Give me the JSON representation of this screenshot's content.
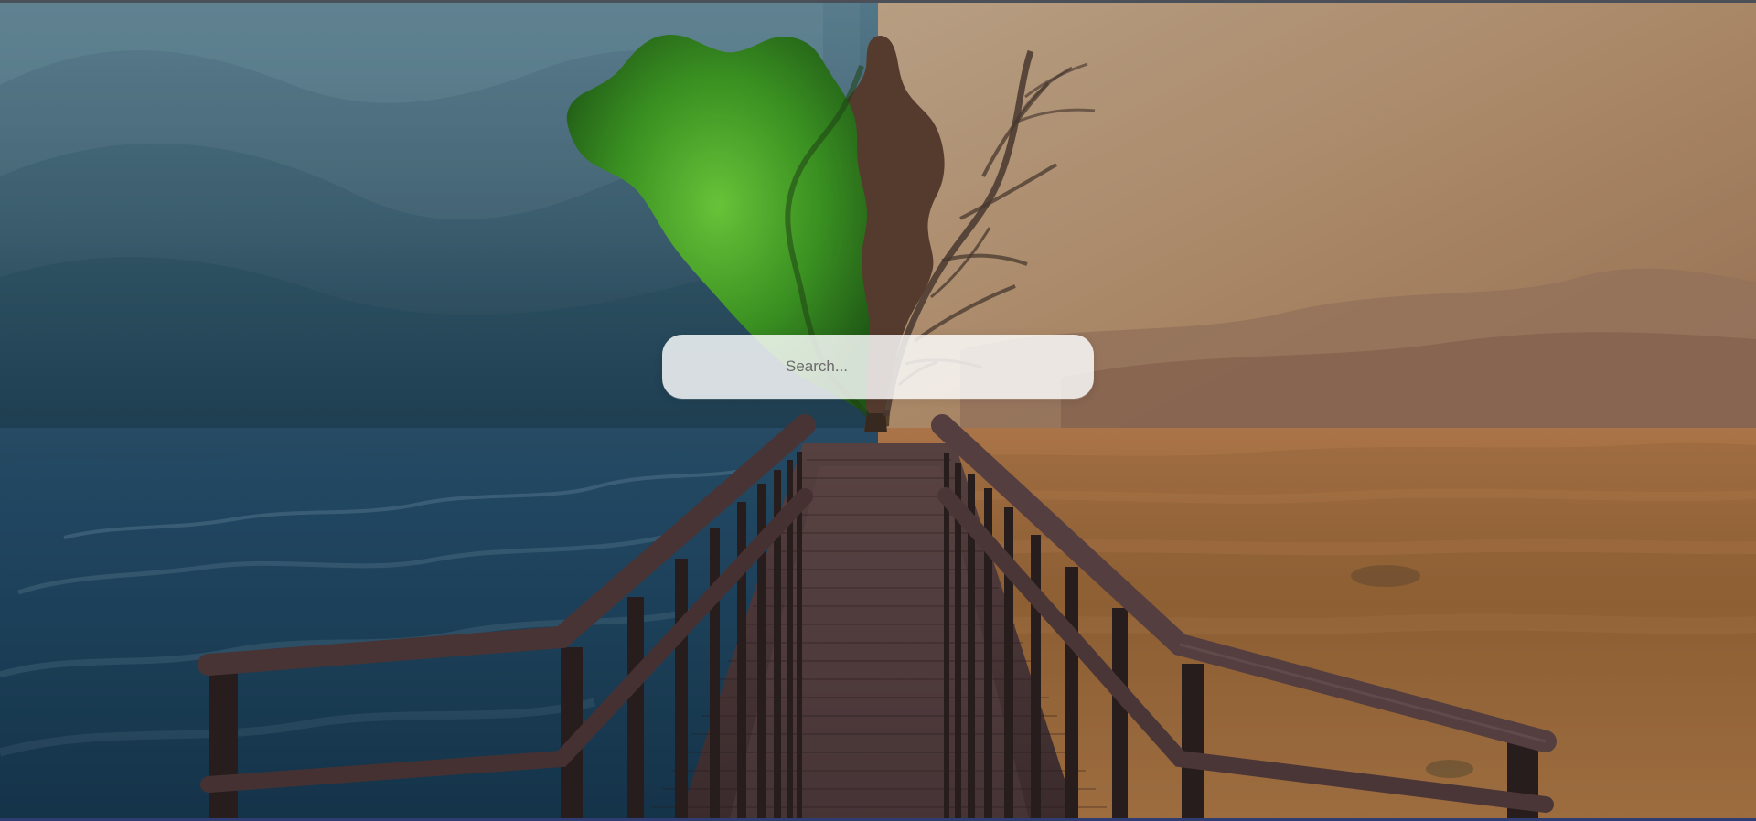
{
  "search": {
    "placeholder": "Search..."
  },
  "background": {
    "left_scene": "stormy-sea",
    "right_scene": "desert-dunes",
    "centerpiece": "split-tree",
    "foreground": "wooden-boardwalk"
  },
  "colors": {
    "sky_left": "#3f6377",
    "sky_right": "#b48f6a",
    "sea_dark": "#1f3f59",
    "sand_mid": "#9c6a3b",
    "wood": "#4b3030",
    "search_bg": "#f2f2f2"
  }
}
